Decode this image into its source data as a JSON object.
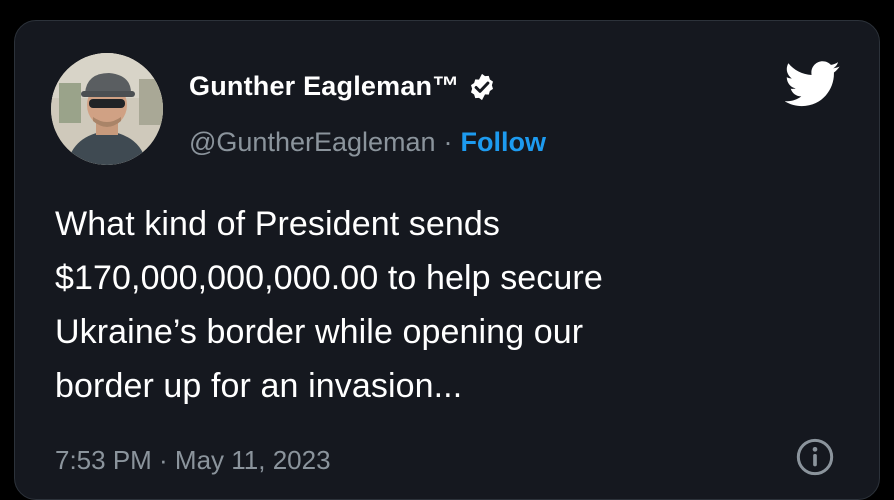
{
  "tweet": {
    "author_name": "Gunther Eagleman™",
    "author_handle": "@GuntherEagleman",
    "separator": "·",
    "follow_label": "Follow",
    "text": "What kind of President sends\n$170,000,000,000.00 to help secure\nUkraine’s border while opening our\nborder up for an invasion...",
    "timestamp": "7:53 PM · May 11, 2023"
  },
  "icons": {
    "verified": "verified-badge-icon",
    "brand": "twitter-bird-icon",
    "info": "info-icon"
  },
  "colors": {
    "background": "#000000",
    "card": "#15181f",
    "text_primary": "#ffffff",
    "text_secondary": "#8b949c",
    "accent": "#1d9bf0"
  }
}
